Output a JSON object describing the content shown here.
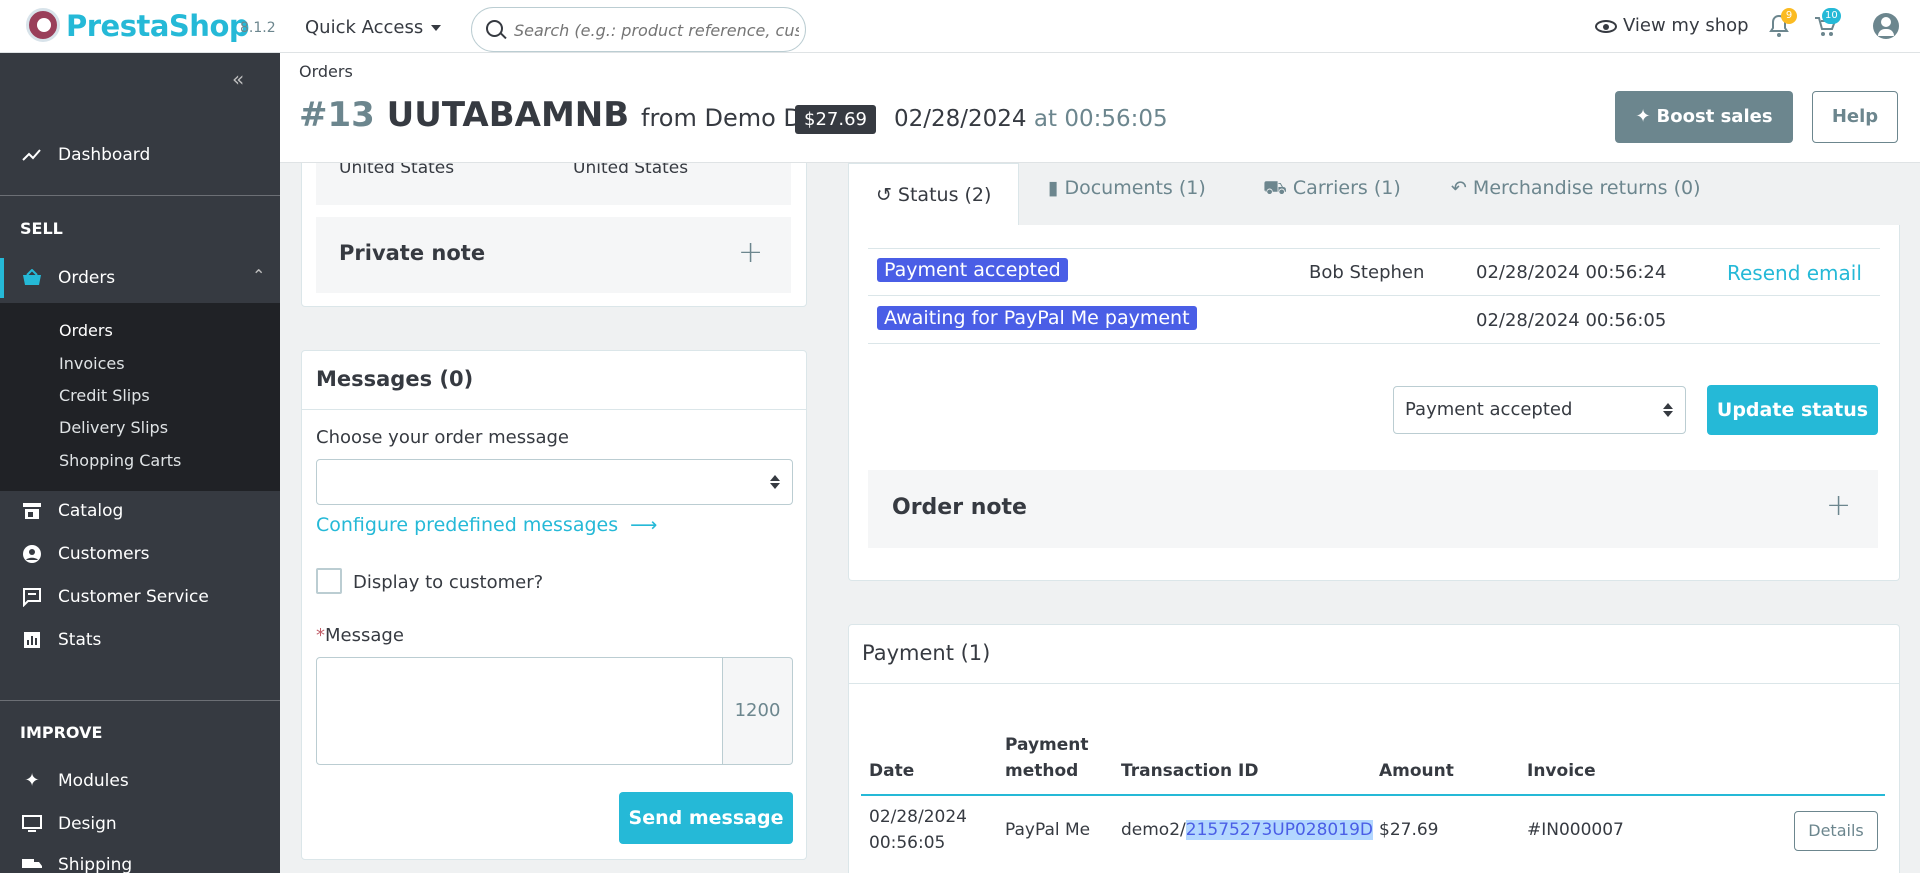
{
  "topbar": {
    "brand": "PrestaShop",
    "version": "8.1.2",
    "quick_access": "Quick Access",
    "search_placeholder": "Search (e.g.: product reference, custon",
    "view_shop": "View my shop",
    "notifications_count": "9",
    "cart_count": "10"
  },
  "sidebar": {
    "dashboard": "Dashboard",
    "sell": "SELL",
    "orders": "Orders",
    "sub": [
      "Orders",
      "Invoices",
      "Credit Slips",
      "Delivery Slips",
      "Shopping Carts"
    ],
    "catalog": "Catalog",
    "customers": "Customers",
    "customer_service": "Customer Service",
    "stats": "Stats",
    "improve": "IMPROVE",
    "modules": "Modules",
    "design": "Design",
    "shipping": "Shipping"
  },
  "header": {
    "breadcrumb": "Orders",
    "order_number": "#13",
    "reference": "UUTABAMNB",
    "from": "from Demo Demo",
    "total": "$27.69",
    "date": "02/28/2024",
    "at_time": "at 00:56:05",
    "boost": "Boost sales",
    "help": "Help"
  },
  "address": {
    "country_1": "United States",
    "country_2": "United States"
  },
  "private_note": {
    "title": "Private note"
  },
  "messages": {
    "title": "Messages (0)",
    "choose_label": "Choose your order message",
    "configure_link": "Configure predefined messages",
    "display_label": "Display to customer?",
    "required_mark": "*",
    "message_label": "Message",
    "counter": "1200",
    "send": "Send message"
  },
  "tabs": {
    "status": "Status (2)",
    "documents": "Documents (1)",
    "carriers": "Carriers (1)",
    "returns": "Merchandise returns (0)"
  },
  "history": [
    {
      "status": "Payment accepted",
      "employee": "Bob Stephen",
      "date": "02/28/2024 00:56:24",
      "action": "Resend email"
    },
    {
      "status": "Awaiting for PayPal Me payment",
      "employee": "",
      "date": "02/28/2024 00:56:05",
      "action": ""
    }
  ],
  "status_select": {
    "value": "Payment accepted"
  },
  "update_status": "Update status",
  "order_note": {
    "title": "Order note"
  },
  "payment": {
    "title": "Payment (1)",
    "headers": {
      "date": "Date",
      "method_1": "Payment",
      "method_2": "method",
      "transaction": "Transaction ID",
      "amount": "Amount",
      "invoice": "Invoice"
    },
    "row": {
      "date_1": "02/28/2024",
      "date_2": "00:56:05",
      "method": "PayPal Me",
      "transaction_prefix": "demo2/",
      "transaction_highlight": "21575273UP028019D",
      "amount": "$27.69",
      "invoice": "#IN000007",
      "details": "Details"
    }
  },
  "colors": {
    "accent": "#25b9d7",
    "status_pill": "#4a5ee6",
    "sidebar": "#363a41",
    "boost": "#6c868e"
  }
}
